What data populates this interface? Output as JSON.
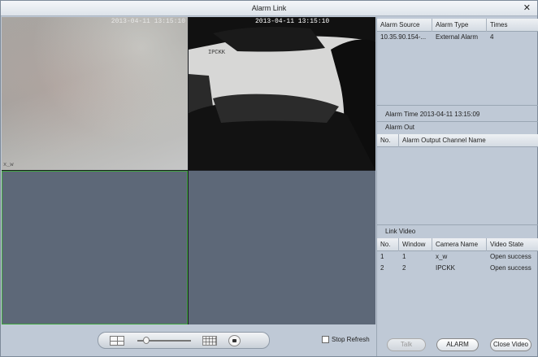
{
  "window": {
    "title": "Alarm Link",
    "close_glyph": "✕"
  },
  "video": {
    "tiles": [
      {
        "timestamp": "2013-04-11 13:15:10",
        "channel": "x_w"
      },
      {
        "timestamp": "2013-04-11 13:15:10",
        "channel": "IPCKK"
      },
      {
        "timestamp": "",
        "channel": ""
      },
      {
        "timestamp": "",
        "channel": ""
      }
    ]
  },
  "controls": {
    "stop_refresh_label": "Stop Refresh",
    "stop_refresh_checked": false
  },
  "alarm_table": {
    "columns": [
      "Alarm Source",
      "Alarm Type",
      "Times"
    ],
    "rows": [
      {
        "source": "10.35.90.154-...",
        "type": "External Alarm",
        "times": "4"
      }
    ]
  },
  "alarm_time": {
    "label": "Alarm Time",
    "value": "2013-04-11 13:15:09"
  },
  "alarm_out": {
    "title": "Alarm Out",
    "columns": [
      "No.",
      "Alarm Output Channel Name"
    ],
    "rows": []
  },
  "link_video": {
    "title": "Link Video",
    "columns": [
      "No.",
      "Window",
      "Camera Name",
      "Video State"
    ],
    "rows": [
      {
        "no": "1",
        "window": "1",
        "camera": "x_w",
        "state": "Open success"
      },
      {
        "no": "2",
        "window": "2",
        "camera": "IPCKK",
        "state": "Open success"
      }
    ]
  },
  "buttons": {
    "talk": "Talk",
    "alarm": "ALARM",
    "close_video": "Close Video"
  }
}
